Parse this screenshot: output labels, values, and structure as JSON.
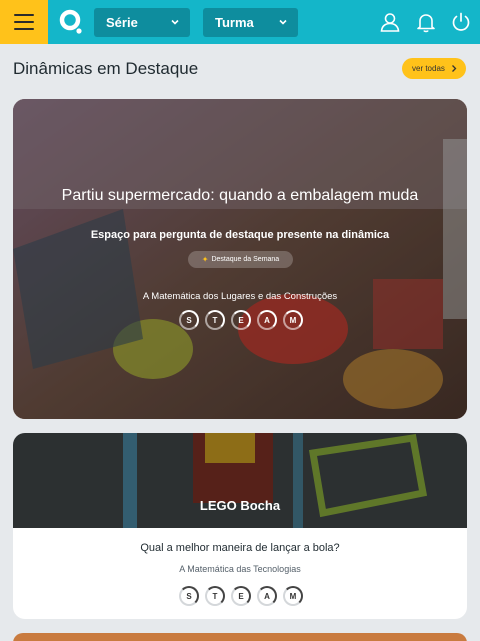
{
  "topbar": {
    "serie_label": "Série",
    "turma_label": "Turma",
    "colors": {
      "bar": "#14b6c9",
      "menu": "#ffc21a",
      "select": "#0e8d9e"
    }
  },
  "section": {
    "title": "Dinâmicas em Destaque",
    "see_all_label": "ver todas"
  },
  "featured": {
    "title": "Partiu supermercado: quando a embalagem muda",
    "question": "Espaço para pergunta de destaque presente na dinâmica",
    "badge": "Destaque da Semana",
    "area": "A Matemática dos Lugares e das Construções",
    "steam": [
      "S",
      "T",
      "E",
      "A",
      "M"
    ]
  },
  "card2": {
    "title": "LEGO Bocha",
    "question": "Qual a melhor maneira de lançar a bola?",
    "area": "A Matemática das Tecnologias",
    "steam": [
      "S",
      "T",
      "E",
      "A",
      "M"
    ]
  }
}
